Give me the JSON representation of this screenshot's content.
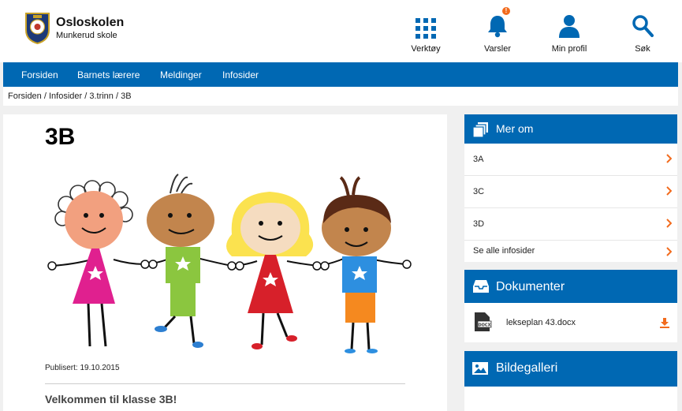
{
  "header": {
    "brand_title": "Osloskolen",
    "brand_sub": "Munkerud skole",
    "logo_icon": "oslo-seal-icon",
    "buttons": [
      {
        "label": "Verktøy",
        "icon": "grid-icon"
      },
      {
        "label": "Varsler",
        "icon": "bell-icon",
        "badge": "!"
      },
      {
        "label": "Min profil",
        "icon": "user-icon"
      },
      {
        "label": "Søk",
        "icon": "search-icon"
      }
    ]
  },
  "nav": {
    "items": [
      "Forsiden",
      "Barnets lærere",
      "Meldinger",
      "Infosider"
    ]
  },
  "breadcrumb": {
    "items": [
      "Forsiden",
      "Infosider",
      "3.trinn",
      "3B"
    ],
    "separator": " / "
  },
  "main": {
    "title": "3B",
    "published": "Publisert: 19.10.2015",
    "welcome": "Velkommen til klasse 3B!"
  },
  "sidebar": {
    "mer_om": {
      "title": "Mer om",
      "items": [
        "3A",
        "3C",
        "3D",
        "Se alle infosider"
      ]
    },
    "dokumenter": {
      "title": "Dokumenter",
      "file_name": "lekseplan 43.docx",
      "file_icon": "docx-file-icon"
    },
    "bildegalleri": {
      "title": "Bildegalleri"
    }
  },
  "colors": {
    "brand_blue": "#0068b3",
    "accent_orange": "#f26b1d"
  }
}
